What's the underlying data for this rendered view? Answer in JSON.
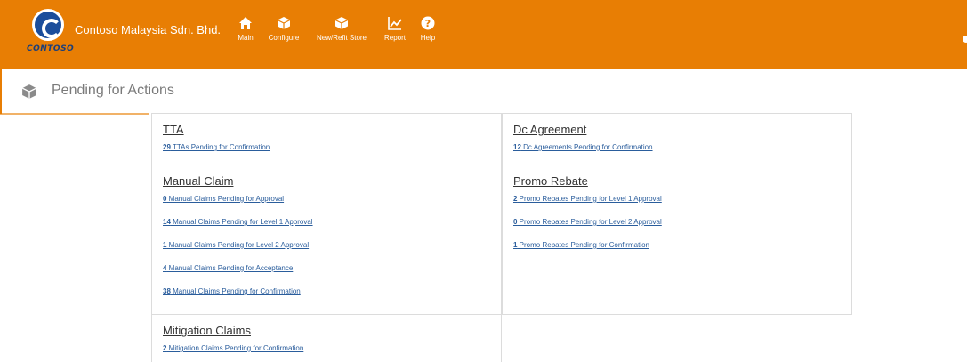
{
  "header": {
    "logo_text": "CONTOSO",
    "company_name": "Contoso Malaysia Sdn. Bhd.",
    "nav": [
      {
        "label": "Main",
        "icon": "home-icon"
      },
      {
        "label": "Configure",
        "icon": "cube-icon"
      },
      {
        "label": "New/Refit Store",
        "icon": "cube-icon"
      },
      {
        "label": "Report",
        "icon": "chart-icon"
      },
      {
        "label": "Help",
        "icon": "help-icon"
      }
    ],
    "accent_color": "#e87e04"
  },
  "page": {
    "title": "Pending for Actions",
    "icon": "cube-icon"
  },
  "cards": {
    "tta": {
      "title": "TTA",
      "items": [
        {
          "count": "29",
          "text": " TTAs Pending for Confirmation"
        }
      ]
    },
    "dc": {
      "title": "Dc Agreement",
      "items": [
        {
          "count": "12",
          "text": " Dc Agreements Pending for Confirmation"
        }
      ]
    },
    "manual": {
      "title": "Manual Claim",
      "items": [
        {
          "count": "0",
          "text": " Manual Claims Pending for Approval"
        },
        {
          "count": "14",
          "text": " Manual Claims Pending for Level 1 Approval"
        },
        {
          "count": "1",
          "text": " Manual Claims Pending for Level 2 Approval"
        },
        {
          "count": "4",
          "text": " Manual Claims Pending for Acceptance"
        },
        {
          "count": "38",
          "text": " Manual Claims Pending for Confirmation"
        }
      ]
    },
    "promo": {
      "title": "Promo Rebate",
      "items": [
        {
          "count": "2",
          "text": " Promo Rebates Pending for Level 1 Approval"
        },
        {
          "count": "0",
          "text": " Promo Rebates Pending for Level 2 Approval"
        },
        {
          "count": "1",
          "text": " Promo Rebates Pending for Confirmation"
        }
      ]
    },
    "mitigation": {
      "title": "Mitigation Claims",
      "items": [
        {
          "count": "2",
          "text": " Mitigation Claims Pending for Confirmation"
        }
      ]
    }
  }
}
